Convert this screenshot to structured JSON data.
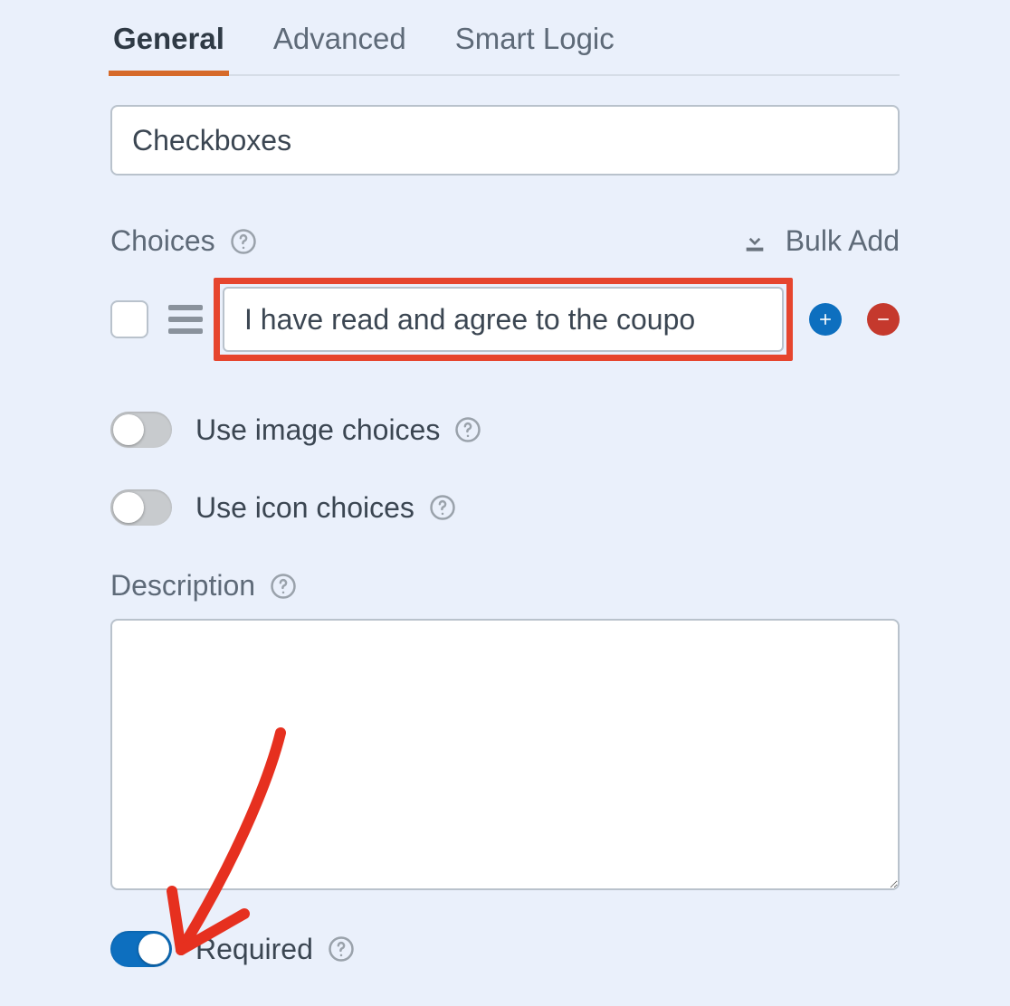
{
  "tabs": {
    "general": "General",
    "advanced": "Advanced",
    "smart_logic": "Smart Logic",
    "active": "general"
  },
  "field_label": "Checkboxes",
  "choices": {
    "label": "Choices",
    "bulk_add": "Bulk Add",
    "items": [
      {
        "value": "I have read and agree to the coupo"
      }
    ]
  },
  "toggles": {
    "use_image_choices": {
      "label": "Use image choices",
      "on": false
    },
    "use_icon_choices": {
      "label": "Use icon choices",
      "on": false
    },
    "required": {
      "label": "Required",
      "on": true
    }
  },
  "description": {
    "label": "Description",
    "value": ""
  }
}
